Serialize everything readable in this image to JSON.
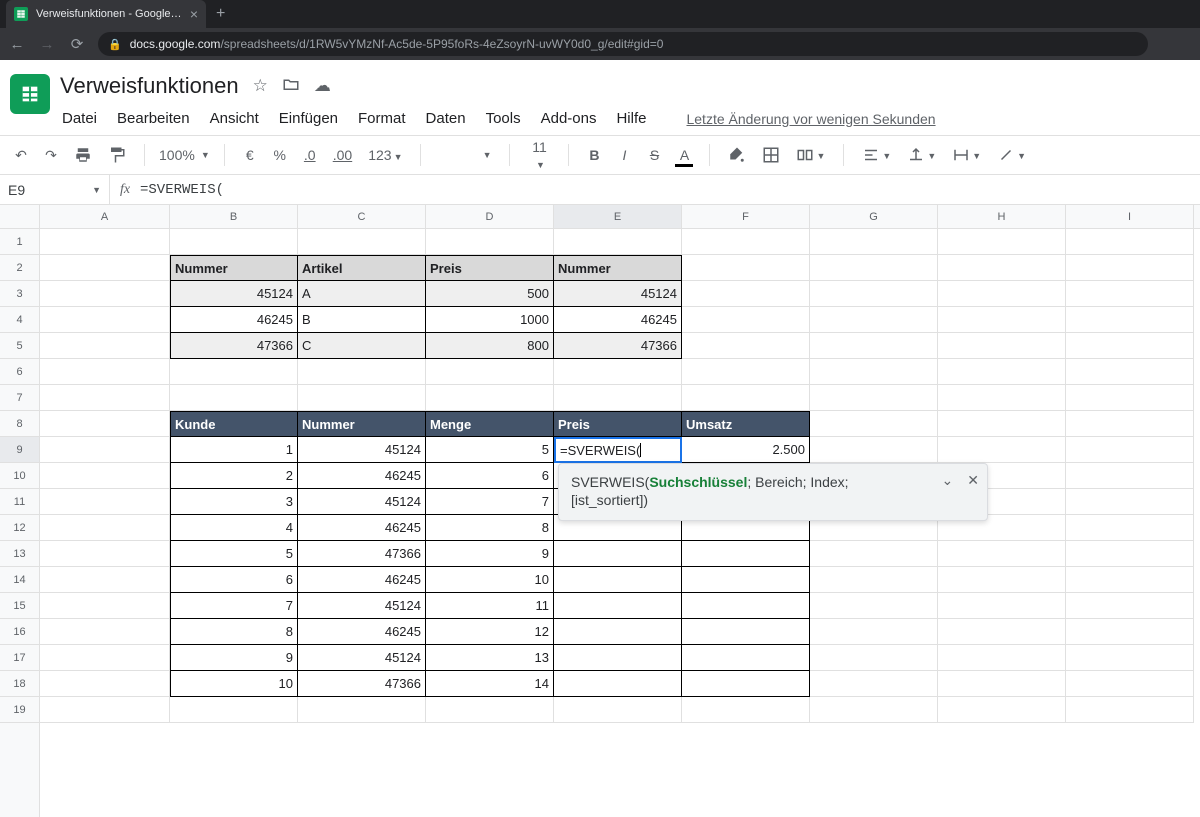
{
  "browser": {
    "tab_title": "Verweisfunktionen - Google Tabe",
    "url_host": "docs.google.com",
    "url_path": "/spreadsheets/d/1RW5vYMzNf-Ac5de-5P95foRs-4eZsoyrN-uvWY0d0_g/edit#gid=0"
  },
  "doc": {
    "title": "Verweisfunktionen",
    "menus": [
      "Datei",
      "Bearbeiten",
      "Ansicht",
      "Einfügen",
      "Format",
      "Daten",
      "Tools",
      "Add-ons",
      "Hilfe"
    ],
    "last_edit": "Letzte Änderung vor wenigen Sekunden"
  },
  "toolbar": {
    "zoom": "100%",
    "currency": "€",
    "percent": "%",
    "dec_less": ".0",
    "dec_more": ".00",
    "numfmt": "123",
    "font": "",
    "fontsize": "11"
  },
  "fx": {
    "namebox": "E9",
    "formula": "=SVERWEIS("
  },
  "columns": [
    "A",
    "B",
    "C",
    "D",
    "E",
    "F",
    "G",
    "H",
    "I"
  ],
  "max_rows": 19,
  "table1": {
    "headers": {
      "B": "Nummer",
      "C": "Artikel",
      "D": "Preis",
      "E": "Nummer"
    },
    "rows": [
      {
        "B": "45124",
        "C": "A",
        "D": "500",
        "E": "45124"
      },
      {
        "B": "46245",
        "C": "B",
        "D": "1000",
        "E": "46245"
      },
      {
        "B": "47366",
        "C": "C",
        "D": "800",
        "E": "47366"
      }
    ]
  },
  "table2": {
    "headers": {
      "B": "Kunde",
      "C": "Nummer",
      "D": "Menge",
      "E": "Preis",
      "F": "Umsatz"
    },
    "rows": [
      {
        "B": "1",
        "C": "45124",
        "D": "5",
        "E": "=SVERWEIS(",
        "F": "2.500"
      },
      {
        "B": "2",
        "C": "46245",
        "D": "6",
        "E": "",
        "F": ""
      },
      {
        "B": "3",
        "C": "45124",
        "D": "7",
        "E": "",
        "F": ""
      },
      {
        "B": "4",
        "C": "46245",
        "D": "8",
        "E": "",
        "F": ""
      },
      {
        "B": "5",
        "C": "47366",
        "D": "9",
        "E": "",
        "F": ""
      },
      {
        "B": "6",
        "C": "46245",
        "D": "10",
        "E": "",
        "F": ""
      },
      {
        "B": "7",
        "C": "45124",
        "D": "11",
        "E": "",
        "F": ""
      },
      {
        "B": "8",
        "C": "46245",
        "D": "12",
        "E": "",
        "F": ""
      },
      {
        "B": "9",
        "C": "45124",
        "D": "13",
        "E": "",
        "F": ""
      },
      {
        "B": "10",
        "C": "47366",
        "D": "14",
        "E": "",
        "F": ""
      }
    ]
  },
  "formula_help": {
    "fn": "SVERWEIS",
    "arg_active": "Suchschlüssel",
    "args_rest": "; Bereich; Index; ",
    "line2": "[ist_sortiert])"
  }
}
